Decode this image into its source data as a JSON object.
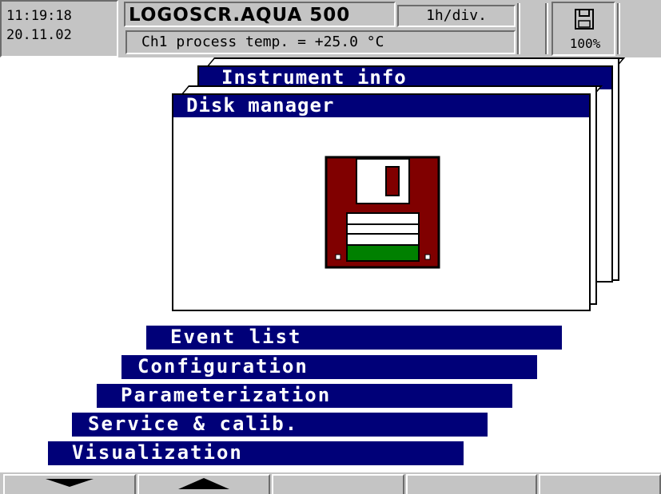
{
  "status": {
    "time": "11:19:18",
    "date": "20.11.02",
    "device_name": "LOGOSCR.AQUA 500",
    "timebase": "1h/div.",
    "channel_readout": "Ch1 process temp.  = +25.0 °C",
    "disk_icon": "floppy-disk-icon",
    "disk_fill": "100%"
  },
  "menu": {
    "instrument_info": "Instrument info",
    "disk_manager": "Disk manager",
    "disk_manager_icon": "floppy-disk-icon",
    "event_list": "Event list",
    "configuration": "Configuration",
    "parameterization": "Parameterization",
    "service_calib": "Service & calib.",
    "visualization": "Visualization"
  },
  "softkeys": [
    {
      "icon": "arrow-down-icon",
      "label": ""
    },
    {
      "icon": "arrow-up-icon",
      "label": ""
    },
    {
      "icon": "",
      "label": ""
    },
    {
      "icon": "",
      "label": ""
    },
    {
      "icon": "",
      "label": ""
    }
  ],
  "colors": {
    "title_bar": "#000078",
    "panel_grey": "#c4c4c4",
    "floppy_body": "#800000",
    "floppy_label_green": "#008000"
  }
}
